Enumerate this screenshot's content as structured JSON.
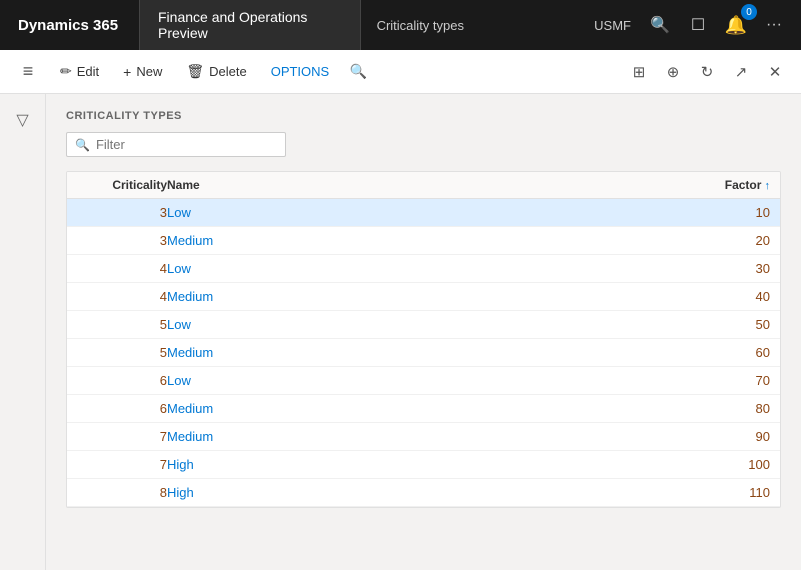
{
  "topNav": {
    "d365Label": "Dynamics 365",
    "appTitle": "Finance and Operations Preview",
    "pageTitle": "Criticality types",
    "usmf": "USMF",
    "searchIcon": "🔍",
    "bookmarkIcon": "☐",
    "moreIcon": "···",
    "notifBadge": "0"
  },
  "toolbar": {
    "hamburgerIcon": "≡",
    "editLabel": "Edit",
    "editIcon": "✏",
    "newLabel": "New",
    "newIcon": "+",
    "deleteLabel": "Delete",
    "deleteIcon": "🗑",
    "optionsLabel": "OPTIONS",
    "searchIcon": "🔍",
    "gridIcon": "⊞",
    "officeIcon": "⊕",
    "refreshIcon": "↻",
    "openNewIcon": "↗",
    "closeIcon": "✕"
  },
  "section": {
    "title": "CRITICALITY TYPES",
    "filterPlaceholder": "Filter"
  },
  "table": {
    "columns": [
      {
        "key": "criticality",
        "label": "Criticality",
        "align": "right"
      },
      {
        "key": "name",
        "label": "Name",
        "align": "left"
      },
      {
        "key": "factor",
        "label": "Factor",
        "align": "right",
        "sorted": "asc"
      }
    ],
    "rows": [
      {
        "criticality": "3",
        "name": "Low",
        "factor": "10",
        "selected": true
      },
      {
        "criticality": "3",
        "name": "Medium",
        "factor": "20",
        "selected": false
      },
      {
        "criticality": "4",
        "name": "Low",
        "factor": "30",
        "selected": false
      },
      {
        "criticality": "4",
        "name": "Medium",
        "factor": "40",
        "selected": false
      },
      {
        "criticality": "5",
        "name": "Low",
        "factor": "50",
        "selected": false
      },
      {
        "criticality": "5",
        "name": "Medium",
        "factor": "60",
        "selected": false
      },
      {
        "criticality": "6",
        "name": "Low",
        "factor": "70",
        "selected": false
      },
      {
        "criticality": "6",
        "name": "Medium",
        "factor": "80",
        "selected": false
      },
      {
        "criticality": "7",
        "name": "Medium",
        "factor": "90",
        "selected": false
      },
      {
        "criticality": "7",
        "name": "High",
        "factor": "100",
        "selected": false
      },
      {
        "criticality": "8",
        "name": "High",
        "factor": "110",
        "selected": false
      }
    ]
  }
}
